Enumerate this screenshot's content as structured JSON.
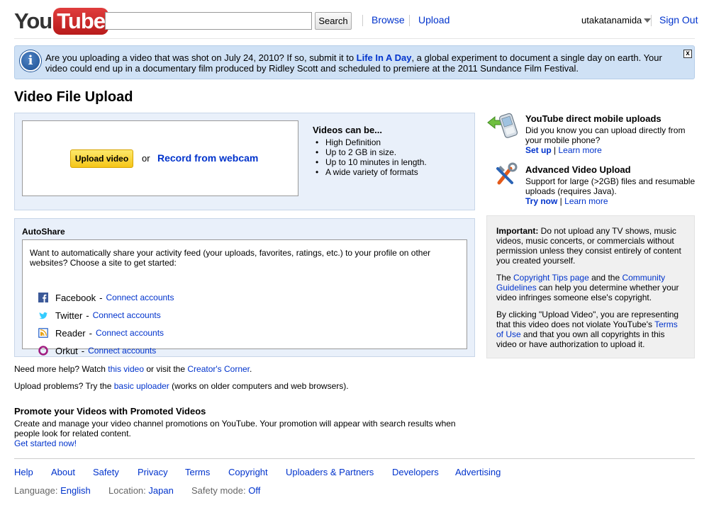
{
  "header": {
    "logo_you": "You",
    "logo_tube": "Tube",
    "search_value": "",
    "search_button": "Search",
    "browse": "Browse",
    "upload": "Upload",
    "username": "utakatanamida",
    "sign_out": "Sign Out"
  },
  "banner": {
    "text_before": "Are you uploading a video that was shot on July 24, 2010? If so, submit it to ",
    "link": "Life In A Day",
    "text_after": ", a global experiment to document a single day on earth. Your video could end up in a documentary film produced by Ridley Scott and scheduled to premiere at the 2011 Sundance Film Festival.",
    "close": "x"
  },
  "page_title": "Video File Upload",
  "upload": {
    "button": "Upload video",
    "or": "or",
    "webcam": "Record from webcam",
    "videos_heading": "Videos can be...",
    "videos_items": [
      "High Definition",
      "Up to 2 GB in size.",
      "Up to 10 minutes in length.",
      "A wide variety of formats"
    ]
  },
  "autoshare": {
    "title": "AutoShare",
    "description": "Want to automatically share your activity feed (your uploads, favorites, ratings, etc.) to your profile on other websites? Choose a site to get started:",
    "services": [
      {
        "name": "Facebook",
        "link": "Connect accounts",
        "icon": "facebook-icon",
        "color": "#3b5998"
      },
      {
        "name": "Twitter",
        "link": "Connect accounts",
        "icon": "twitter-icon",
        "color": "#33ccff"
      },
      {
        "name": "Reader",
        "link": "Connect accounts",
        "icon": "reader-icon",
        "color": "#4a7bd0"
      },
      {
        "name": "Orkut",
        "link": "Connect accounts",
        "icon": "orkut-icon",
        "color": "#a01c80"
      }
    ]
  },
  "help": {
    "line1_a": "Need more help? Watch ",
    "line1_link1": "this video",
    "line1_b": " or visit the ",
    "line1_link2": "Creator's Corner",
    "line1_c": ".",
    "line2_a": "Upload problems? Try the ",
    "line2_link": "basic uploader",
    "line2_b": " (works on older computers and web browsers)."
  },
  "promote": {
    "title": "Promote your Videos with Promoted Videos",
    "description": "Create and manage your video channel promotions on YouTube. Your promotion will appear with search results when people look for related content.",
    "link": "Get started now!"
  },
  "sidebar": {
    "mobile_title": "YouTube direct mobile uploads",
    "mobile_text": "Did you know you can upload directly from your mobile phone?",
    "mobile_setup": "Set up",
    "mobile_learn": "Learn more",
    "advanced_title": "Advanced Video Upload",
    "advanced_text": "Support for large (>2GB) files and resumable uploads (requires Java).",
    "advanced_try": "Try now",
    "advanced_learn": "Learn more",
    "link_sep": " | "
  },
  "important": {
    "label": "Important:",
    "p1": " Do not upload any TV shows, music videos, music concerts, or commercials without permission unless they consist entirely of content you created yourself.",
    "p2_a": "The ",
    "p2_link1": "Copyright Tips page",
    "p2_b": " and the ",
    "p2_link2": "Community Guidelines",
    "p2_c": " can help you determine whether your video infringes someone else's copyright.",
    "p3_a": "By clicking \"Upload Video\", you are representing that this video does not violate YouTube's ",
    "p3_link": "Terms of Use",
    "p3_b": " and that you own all copyrights in this video or have authorization to upload it."
  },
  "footer": {
    "links": [
      "Help",
      "About",
      "Safety",
      "Privacy",
      "Terms",
      "Copyright",
      "Uploaders & Partners",
      "Developers",
      "Advertising"
    ],
    "language_label": "Language: ",
    "language_value": "English",
    "location_label": "Location: ",
    "location_value": "Japan",
    "safety_label": "Safety mode: ",
    "safety_value": "Off"
  }
}
